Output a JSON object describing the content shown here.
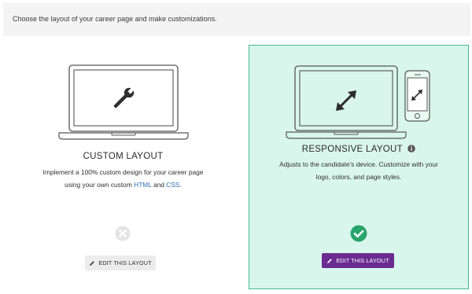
{
  "header": {
    "instruction": "Choose the layout of your career page and make customizations."
  },
  "layouts": [
    {
      "title": "CUSTOM LAYOUT",
      "desc_line1": "Implement a 100% custom design for your career page",
      "desc_line2_prefix": "using your own custom ",
      "desc_line2_html": "HTML",
      "desc_line2_and": " and ",
      "desc_line2_css": "CSS",
      "desc_line2_suffix": ".",
      "edit_label": "EDIT THIS LAYOUT",
      "selected": false
    },
    {
      "title": "RESPONSIVE LAYOUT",
      "desc_line1": "Adjusts to the candidate's device. Customize with your",
      "desc_line2": "logo, colors, and page styles.",
      "edit_label": "EDIT THIS LAYOUT",
      "selected": true
    }
  ],
  "colors": {
    "selected_bg": "#d9f6ec",
    "selected_border": "#46b98e",
    "check_green": "#27a46c",
    "primary_button": "#6a2c91",
    "link_blue": "#2a6db5"
  },
  "icons": {
    "custom": "wrench-icon",
    "responsive": "expand-arrows-icon",
    "info": "info-icon",
    "unselected": "x-circle-icon",
    "selected": "check-circle-icon",
    "edit": "pencil-icon"
  }
}
